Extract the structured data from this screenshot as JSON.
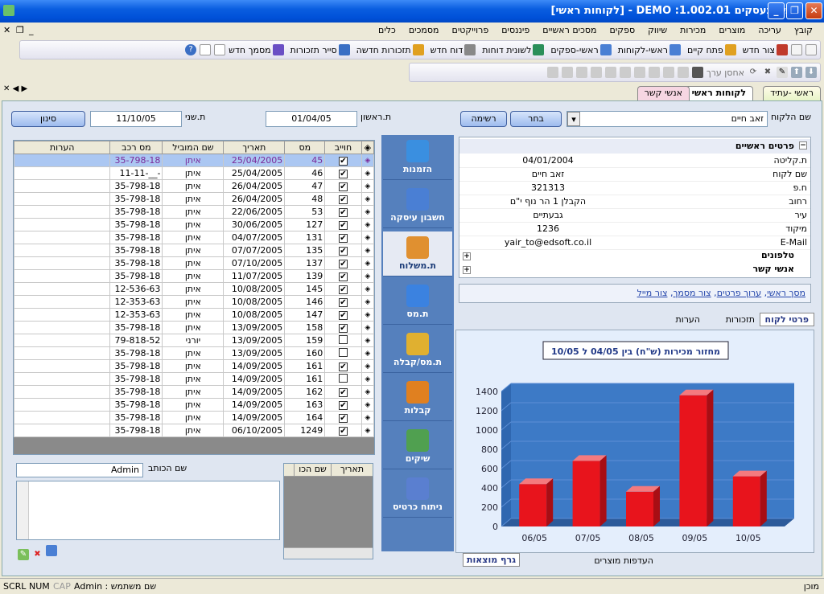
{
  "window": {
    "title": "עתיד בעסקים DEMO :1.002.01 - [לקוחות ראשי]"
  },
  "menu": [
    "קובץ",
    "עריכה",
    "מוצרים",
    "מכירות",
    "שיווק",
    "ספקים",
    "מסכים ראשיים",
    "פיננסים",
    "פרוייקטים",
    "מסמכים",
    "כלים"
  ],
  "toolbar1": [
    "צור חדש",
    "פתח קיים",
    "ראשי-לקוחות",
    "ראשי-ספקים",
    "לשונית דוחות",
    "דוח חדש",
    "תזכורות חדשה",
    "סייר תזכורות",
    "מסמך חדש"
  ],
  "toolbar2": {
    "save_label": "אחסן ערך"
  },
  "tabs": {
    "t1": "ראשי -עתיד",
    "t2": "לקוחות ראשי",
    "t3": "אנשי קשר"
  },
  "customer": {
    "name_label": "שם הלקוח",
    "name_value": "זאב חיים",
    "select_btn": "בחר",
    "list_btn": "רשימה"
  },
  "details": {
    "section_main": "פרטים ראשיים",
    "rows": [
      {
        "label": "ת.קליטה",
        "value": "04/01/2004"
      },
      {
        "label": "שם לקוח",
        "value": "זאב חיים"
      },
      {
        "label": "ח.פ",
        "value": "321313"
      },
      {
        "label": "רחוב",
        "value": "הקבלן 1 הר נוף י\"ם"
      },
      {
        "label": "עיר",
        "value": "גבעתיים"
      },
      {
        "label": "מיקוד",
        "value": "1236"
      },
      {
        "label": "E-Mail",
        "value": "yair_to@edsoft.co.il"
      }
    ],
    "section_phones": "טלפונים",
    "section_contacts": "אנשי קשר"
  },
  "links": {
    "main": "מסך ראשי",
    "edit": "ערוך פרטים",
    "doc": "צור מסמך",
    "mail": "צור מייל"
  },
  "subtabs": {
    "details": "פרטי לקוח",
    "reminders": "תזכורות",
    "notes": "הערות"
  },
  "chart_data": {
    "type": "bar",
    "title": "מחזור מכירות (ש\"ח) בין 04/05 ל 10/05",
    "categories": [
      "06/05",
      "07/05",
      "08/05",
      "09/05",
      "10/05"
    ],
    "values": [
      440,
      680,
      360,
      1360,
      520
    ],
    "ylim": [
      0,
      1400
    ],
    "yticks": [
      0,
      200,
      400,
      600,
      800,
      1000,
      1200,
      1400
    ],
    "color": "#e8141c",
    "background": "#3d7ac6"
  },
  "bottomtabs": {
    "chart": "גרף מוצאות",
    "prefs": "העדפות מוצרים"
  },
  "dates": {
    "from_label": "ת.ראשון",
    "from_value": "01/04/05",
    "to_label": "ת.שני",
    "to_value": "11/10/05",
    "filter_btn": "סינון"
  },
  "nav": [
    "הזמנות",
    "חשבון עיסקה",
    "ת.משלוח",
    "ת.מס",
    "ת.מס/קבלה",
    "קבלות",
    "שיקים",
    "ניתוח כרטיס"
  ],
  "orders": {
    "headers": [
      "הערות",
      "מס רכב",
      "שם המוביל",
      "תאריך",
      "מס",
      "חוייב"
    ],
    "rows": [
      [
        "",
        "35-798-18",
        "איתן",
        "25/04/2005",
        "45",
        true
      ],
      [
        "",
        "11-11-__-",
        "איתן",
        "25/04/2005",
        "46",
        true
      ],
      [
        "",
        "35-798-18",
        "איתן",
        "26/04/2005",
        "47",
        true
      ],
      [
        "",
        "35-798-18",
        "איתן",
        "26/04/2005",
        "48",
        true
      ],
      [
        "",
        "35-798-18",
        "איתן",
        "22/06/2005",
        "53",
        true
      ],
      [
        "",
        "35-798-18",
        "איתן",
        "30/06/2005",
        "127",
        true
      ],
      [
        "",
        "35-798-18",
        "איתן",
        "04/07/2005",
        "131",
        true
      ],
      [
        "",
        "35-798-18",
        "איתן",
        "07/07/2005",
        "135",
        true
      ],
      [
        "",
        "35-798-18",
        "איתן",
        "07/10/2005",
        "137",
        true
      ],
      [
        "",
        "35-798-18",
        "איתן",
        "11/07/2005",
        "139",
        true
      ],
      [
        "",
        "12-536-63",
        "איתן",
        "10/08/2005",
        "145",
        true
      ],
      [
        "",
        "12-353-63",
        "איתן",
        "10/08/2005",
        "146",
        true
      ],
      [
        "",
        "12-353-63",
        "איתן",
        "10/08/2005",
        "147",
        true
      ],
      [
        "",
        "35-798-18",
        "איתן",
        "13/09/2005",
        "158",
        true
      ],
      [
        "",
        "79-818-52",
        "יורני",
        "13/09/2005",
        "159",
        false
      ],
      [
        "",
        "35-798-18",
        "איתן",
        "13/09/2005",
        "160",
        false
      ],
      [
        "",
        "35-798-18",
        "איתן",
        "14/09/2005",
        "161",
        true
      ],
      [
        "",
        "35-798-18",
        "איתן",
        "14/09/2005",
        "161",
        false
      ],
      [
        "",
        "35-798-18",
        "איתן",
        "14/09/2005",
        "162",
        true
      ],
      [
        "",
        "35-798-18",
        "איתן",
        "14/09/2005",
        "163",
        true
      ],
      [
        "",
        "35-798-18",
        "איתן",
        "14/09/2005",
        "164",
        true
      ],
      [
        "",
        "35-798-18",
        "איתן",
        "06/10/2005",
        "1249",
        true
      ]
    ]
  },
  "notes": {
    "writer_label": "שם הכותב",
    "writer_value": "Admin",
    "date_col": "תאריך",
    "name_col": "שם הכו"
  },
  "status": {
    "ready": "מוכן",
    "user": "שם משתמש : Admin",
    "cap": "CAP",
    "num": "NUM",
    "scrl": "SCRL"
  }
}
